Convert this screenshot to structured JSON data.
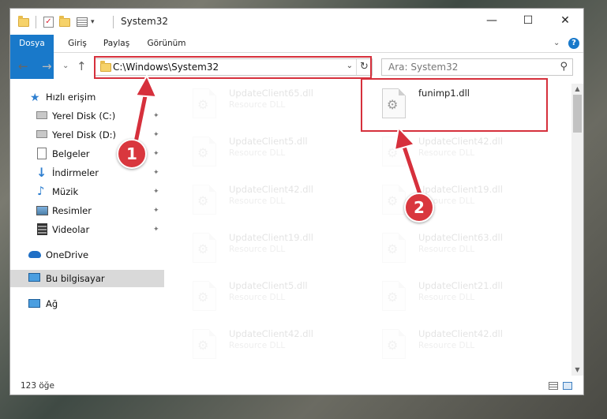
{
  "window": {
    "title": "System32",
    "controls": {
      "minimize": "—",
      "maximize": "☐",
      "close": "✕"
    }
  },
  "ribbon": {
    "tabs": [
      {
        "label": "Dosya",
        "active": true
      },
      {
        "label": "Giriş"
      },
      {
        "label": "Paylaş"
      },
      {
        "label": "Görünüm"
      }
    ],
    "expand": "⌄",
    "help": "?"
  },
  "nav": {
    "back": "←",
    "forward": "→",
    "recent": "⌄",
    "up": "↑",
    "address": "C:\\Windows\\System32",
    "address_caret": "⌄",
    "refresh": "↻",
    "search_placeholder": "Ara: System32",
    "search_icon": "⚲"
  },
  "sidebar": {
    "items": [
      {
        "label": "Hızlı erişim",
        "icon": "star-icon",
        "pinned": false
      },
      {
        "label": "Yerel Disk (C:)",
        "icon": "drive-icon",
        "pinned": true
      },
      {
        "label": "Yerel Disk (D:)",
        "icon": "drive-icon",
        "pinned": true
      },
      {
        "label": "Belgeler",
        "icon": "documents-icon",
        "pinned": true
      },
      {
        "label": "İndirmeler",
        "icon": "download-icon",
        "pinned": true
      },
      {
        "label": "Müzik",
        "icon": "music-icon",
        "pinned": true
      },
      {
        "label": "Resimler",
        "icon": "pictures-icon",
        "pinned": true
      },
      {
        "label": "Videolar",
        "icon": "video-icon",
        "pinned": true
      },
      {
        "label": "OneDrive",
        "icon": "cloud-icon",
        "pinned": false
      },
      {
        "label": "Bu bilgisayar",
        "icon": "computer-icon",
        "pinned": false,
        "selected": true
      },
      {
        "label": "Ağ",
        "icon": "network-icon",
        "pinned": false
      }
    ],
    "pin_glyph": "📌"
  },
  "files": {
    "left": [
      {
        "name": "UpdateClient65.dll",
        "type": "Resource DLL"
      },
      {
        "name": "UpdateClient5.dll",
        "type": "Resource DLL"
      },
      {
        "name": "UpdateClient42.dll",
        "type": "Resource DLL"
      },
      {
        "name": "UpdateClient19.dll",
        "type": "Resource DLL"
      },
      {
        "name": "UpdateClient5.dll",
        "type": "Resource DLL"
      },
      {
        "name": "UpdateClient42.dll",
        "type": "Resource DLL"
      }
    ],
    "right": [
      {
        "name": "funimp1.dll",
        "type": "",
        "highlight": true
      },
      {
        "name": "UpdateClient42.dll",
        "type": "Resource DLL"
      },
      {
        "name": "UpdateClient19.dll",
        "type": "Resource DLL"
      },
      {
        "name": "UpdateClient63.dll",
        "type": "Resource DLL"
      },
      {
        "name": "UpdateClient21.dll",
        "type": "Resource DLL"
      },
      {
        "name": "UpdateClient42.dll",
        "type": "Resource DLL"
      }
    ]
  },
  "status": {
    "count": "123 öğe"
  },
  "annotations": {
    "step1": "1",
    "step2": "2",
    "color": "#d6303c"
  },
  "scroll": {
    "up": "▲",
    "down": "▼"
  }
}
